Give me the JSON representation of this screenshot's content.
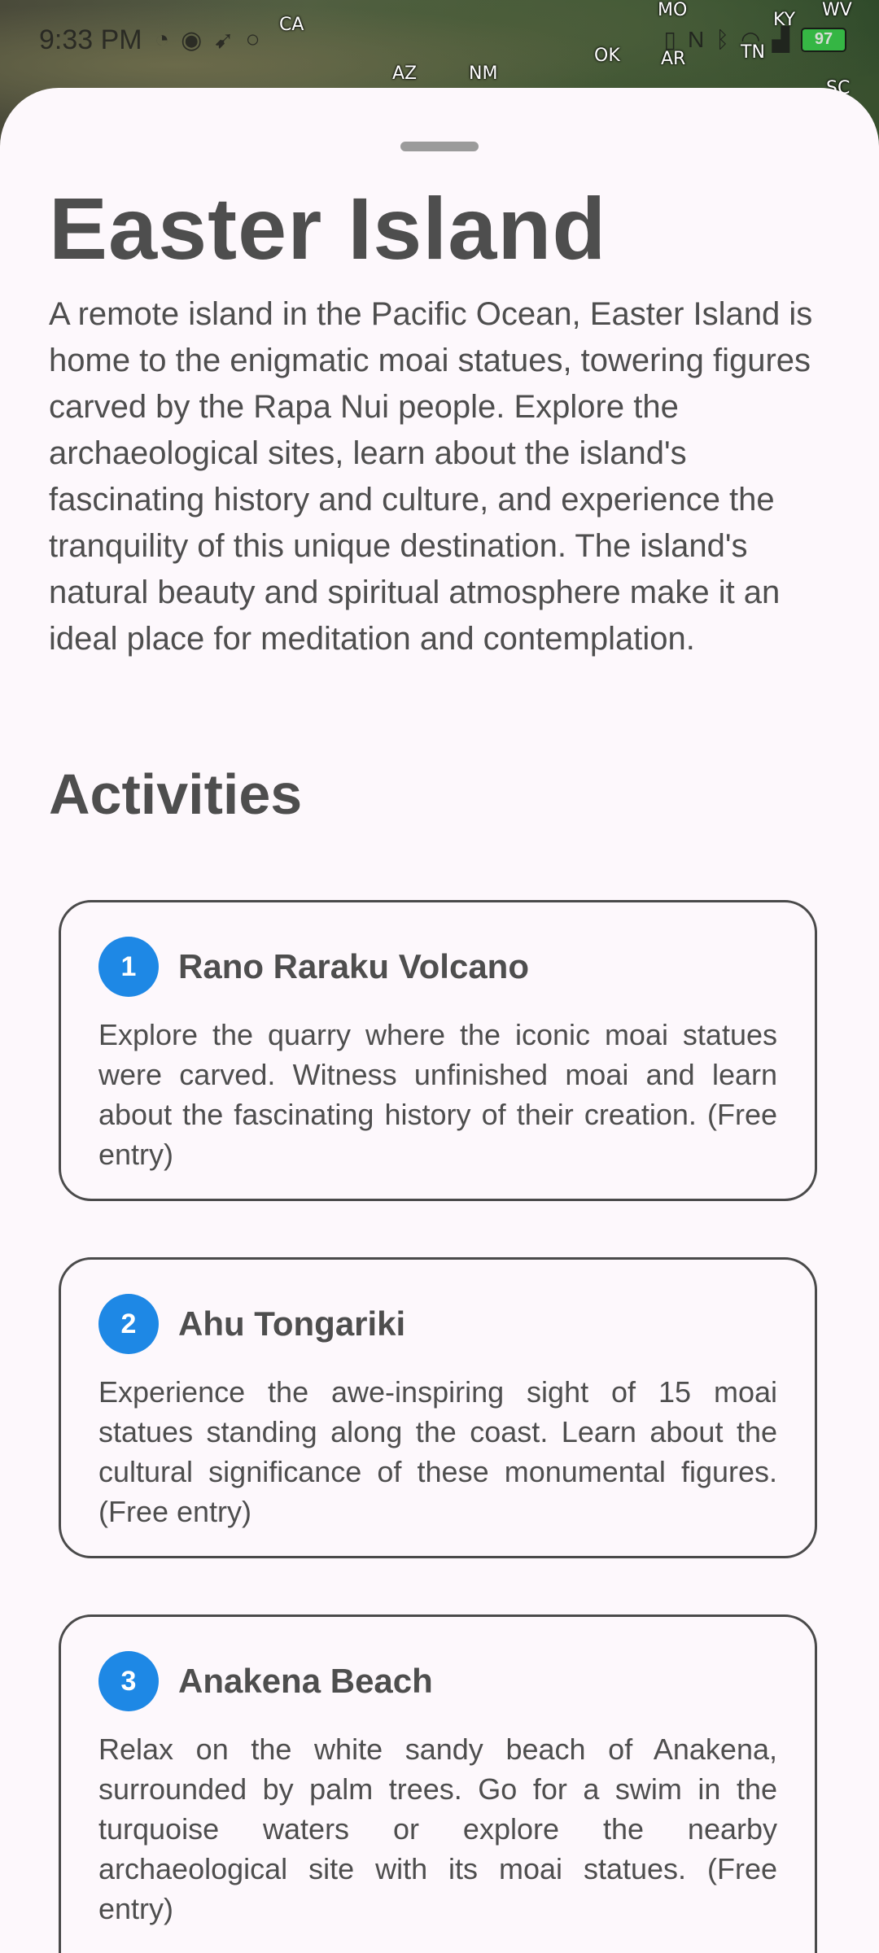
{
  "status_bar": {
    "time": "9:33 PM",
    "battery_level": "97"
  },
  "map": {
    "labels": [
      "CA",
      "AZ",
      "NM",
      "OK",
      "AR",
      "MO",
      "KY",
      "TN",
      "WV",
      "SC"
    ]
  },
  "destination": {
    "title": "Easter Island",
    "description": "A remote island in the Pacific Ocean, Easter Island is home to the enigmatic moai statues, towering figures carved by the Rapa Nui people. Explore the archaeological sites, learn about the island's fascinating history and culture, and experience the tranquility of this unique destination. The island's natural beauty and spiritual atmosphere make it an ideal place for meditation and contemplation."
  },
  "activities": {
    "heading": "Activities",
    "items": [
      {
        "number": "1",
        "name": "Rano Raraku Volcano",
        "text": "Explore the quarry where the iconic moai statues were carved. Witness unfinished moai and learn about the fascinating history of their creation. (Free entry)"
      },
      {
        "number": "2",
        "name": "Ahu Tongariki",
        "text": "Experience the awe-inspiring sight of 15 moai statues standing along the coast. Learn about the cultural significance of these monumental figures. (Free entry)"
      },
      {
        "number": "3",
        "name": "Anakena Beach",
        "text": "Relax on the white sandy beach of Anakena, surrounded by palm trees. Go for a swim in the turquoise waters or explore the nearby archaeological site with its moai statues. (Free entry)"
      }
    ]
  },
  "colors": {
    "accent": "#1e88e5",
    "sheet_background": "#fdf8fc",
    "text": "#4e4e4e"
  }
}
